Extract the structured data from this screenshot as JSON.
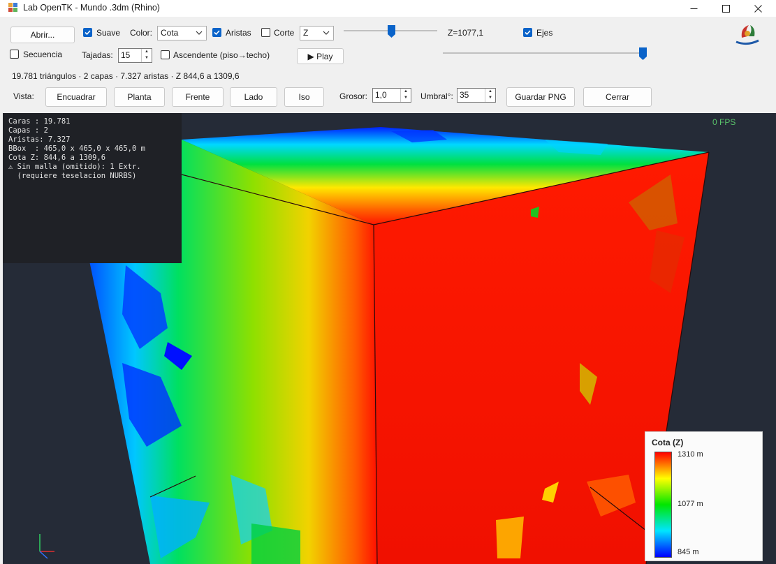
{
  "window": {
    "title": "Lab OpenTK - Mundo .3dm (Rhino)"
  },
  "toolbar": {
    "open_label": "Abrir...",
    "smooth_label": "Suave",
    "color_label": "Color:",
    "color_value": "Cota",
    "edges_label": "Aristas",
    "cut_label": "Corte",
    "axis_value": "Z",
    "z_readout": "Z=1077,1",
    "axes_label": "Ejes",
    "sequence_label": "Secuencia",
    "slices_label": "Tajadas:",
    "slices_value": "15",
    "ascending_label": "Ascendente (piso→techo)",
    "play_label": "▶ Play",
    "stats": "19.781 triángulos · 2 capas · 7.327 aristas · Z 844,6 a 1309,6",
    "view_label": "Vista:",
    "view_buttons": [
      "Encuadrar",
      "Planta",
      "Frente",
      "Lado",
      "Iso"
    ],
    "thickness_label": "Grosor:",
    "thickness_value": "1,0",
    "threshold_label": "Umbral°:",
    "threshold_value": "35",
    "save_png_label": "Guardar PNG",
    "close_label": "Cerrar",
    "smooth_checked": true,
    "edges_checked": true,
    "cut_checked": false,
    "axes_checked": true,
    "sequence_checked": false,
    "ascending_checked": false
  },
  "info_panel": {
    "lines": [
      "Caras : 19.781",
      "Capas : 2",
      "Aristas: 7.327",
      "BBox  : 465,0 x 465,0 x 465,0 m",
      "Cota Z: 844,6 a 1309,6",
      "⚠ Sin malla (omitido): 1 Extr.",
      "  (requiere teselacion NURBS)"
    ]
  },
  "fps": "0 FPS",
  "legend": {
    "title": "Cota (Z)",
    "max": "1310 m",
    "mid": "1077 m",
    "min": "845 m",
    "colors": [
      "#ff0000",
      "#ffff00",
      "#00e600",
      "#00e5ff",
      "#0000ff"
    ]
  }
}
